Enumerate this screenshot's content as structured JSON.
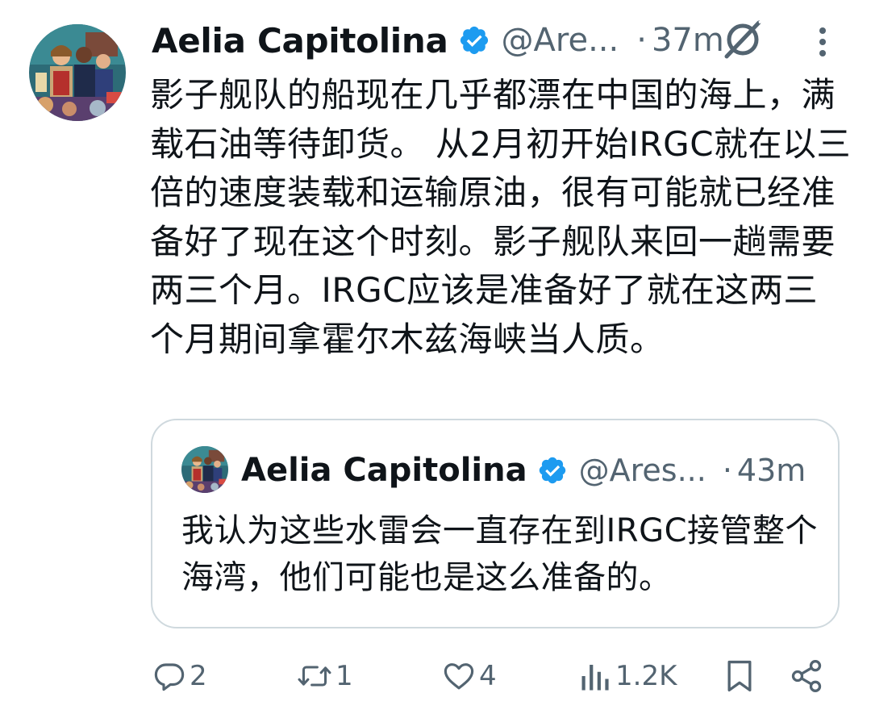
{
  "tweet": {
    "author_name": "Aelia Capitolina",
    "handle": "@Are...",
    "separator": "·",
    "time": "37m",
    "text": "影子舰队的船现在几乎都漂在中国的海上，满载石油等待卸货。 从2月初开始IRGC就在以三倍的速度装载和运输原油，很有可能就已经准备好了现在这个时刻。影子舰队来回一趟需要两三个月。IRGC应该是准备好了就在这两三个月期间拿霍尔木兹海峡当人质。",
    "icons": {
      "verified": "verified-badge-icon",
      "grok": "grok-icon",
      "more": "more-options-icon"
    }
  },
  "quoted_tweet": {
    "author_name": "Aelia Capitolina",
    "handle": "@Ares...",
    "separator": "·",
    "time": "43m",
    "text": "我认为这些水雷会一直存在到IRGC接管整个海湾，他们可能也是这么准备的。"
  },
  "actions": {
    "replies": "2",
    "reposts": "1",
    "likes": "4",
    "views": "1.2K"
  },
  "colors": {
    "text": "#0f1419",
    "secondary": "#536471",
    "verified_blue": "#1d9bf0",
    "border": "#cfd9de"
  }
}
